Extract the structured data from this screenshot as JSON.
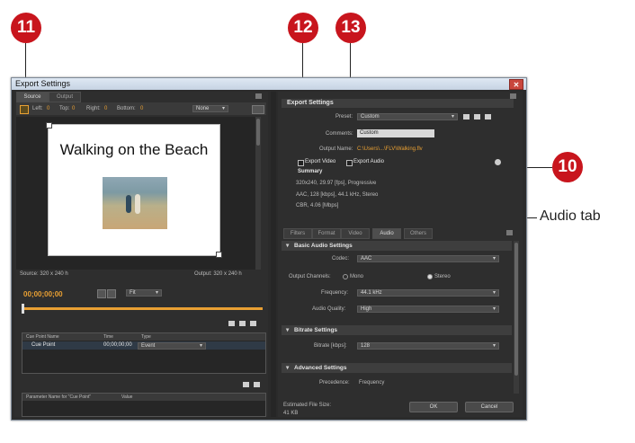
{
  "callouts": [
    "11",
    "12",
    "13",
    "10"
  ],
  "callout_label": "Audio tab",
  "window": {
    "title": "Export Settings",
    "close_glyph": "✕"
  },
  "left": {
    "tabs": [
      "Source",
      "Output"
    ],
    "crop": {
      "left_label": "Left:",
      "left_val": "0",
      "top_label": "Top:",
      "top_val": "0",
      "right_label": "Right:",
      "right_val": "0",
      "bottom_label": "Bottom:",
      "bottom_val": "0",
      "mode": "None"
    },
    "preview_title": "Walking on the Beach",
    "source_info": "Source: 320 x 240 h",
    "output_info": "Output: 320 x 240 h",
    "timecode": "00;00;00;00",
    "fit": "Fit",
    "cue_headers": [
      "Cue Point Name",
      "Time",
      "Type"
    ],
    "cue_row": {
      "name": "Cue Point",
      "time": "00;00;00;00",
      "type": "Event"
    },
    "param_headers": [
      "Parameter Name for \"Cue Point\"",
      "Value"
    ]
  },
  "right": {
    "header": "Export Settings",
    "preset_label": "Preset:",
    "preset_value": "Custom",
    "comments_label": "Comments:",
    "comments_value": "Custom",
    "output_name_label": "Output Name:",
    "output_name_value": "C:\\Users\\...\\FLV\\Walking.flv",
    "export_video": "Export Video",
    "export_audio": "Export Audio",
    "summary_label": "Summary",
    "summary_lines": [
      "320x240, 29.97 [fps], Progressive",
      "AAC, 128 [kbps], 44.1 kHz, Stereo",
      "CBR, 4.06 [Mbps]"
    ],
    "tabs": [
      "Filters",
      "Format",
      "Video",
      "Audio",
      "Others"
    ],
    "basic_audio": "Basic Audio Settings",
    "codec_label": "Codec:",
    "codec_value": "AAC",
    "channels_label": "Output Channels:",
    "mono": "Mono",
    "stereo": "Stereo",
    "frequency_label": "Frequency:",
    "frequency_value": "44.1 kHz",
    "quality_label": "Audio Quality:",
    "quality_value": "High",
    "bitrate_section": "Bitrate Settings",
    "bitrate_label": "Bitrate [kbps]:",
    "bitrate_value": "128",
    "advanced_section": "Advanced Settings",
    "precedence_label": "Precedence:",
    "precedence_value": "Frequency",
    "file_size_label": "Estimated File Size:",
    "file_size_value": "41 KB",
    "ok": "OK",
    "cancel": "Cancel"
  }
}
